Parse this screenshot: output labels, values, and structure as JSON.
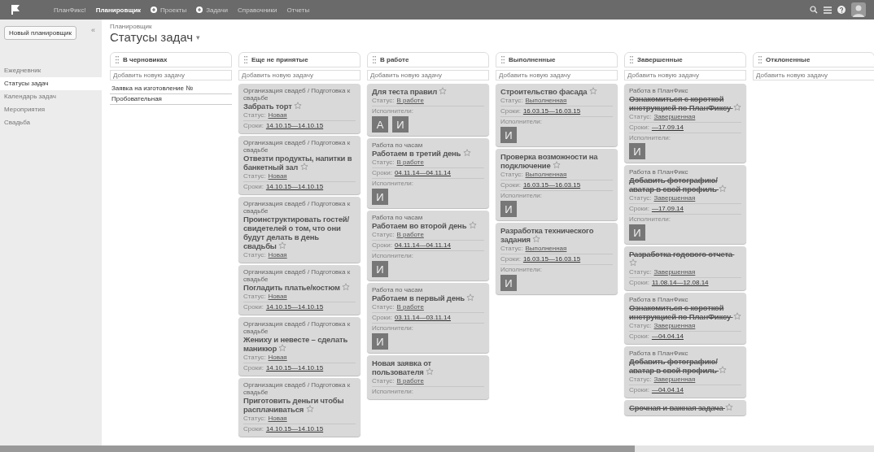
{
  "topbar": {
    "nav": [
      {
        "label": "ПланФикс!",
        "selected": false,
        "plus": false
      },
      {
        "label": "Планировщик",
        "selected": true,
        "plus": false
      },
      {
        "label": "Проекты",
        "selected": false,
        "plus": true
      },
      {
        "label": "Задачи",
        "selected": false,
        "plus": true
      },
      {
        "label": "Справочники",
        "selected": false,
        "plus": false
      },
      {
        "label": "Отчеты",
        "selected": false,
        "plus": false
      }
    ]
  },
  "sidebar": {
    "collapse": "«",
    "new_button": "Новый планировщик",
    "items": [
      {
        "label": "Ежедневник",
        "selected": false
      },
      {
        "label": "Статусы задач",
        "selected": true
      },
      {
        "label": "Календарь задач",
        "selected": false
      },
      {
        "label": "Мероприятия",
        "selected": false
      },
      {
        "label": "Свадьба",
        "selected": false
      }
    ]
  },
  "header": {
    "breadcrumb": "Планировщик",
    "title": "Статусы задач",
    "caret": "▾"
  },
  "columns": [
    {
      "title": "В черновиках",
      "placeholder": "Добавить новую задачу",
      "list": [
        "Заявка на изготовление №",
        "Пробовательная"
      ]
    },
    {
      "title": "Еще не принятые",
      "placeholder": "Добавить новую задачу",
      "cards": [
        {
          "project": "Организация свадеб / Подготовка к свадьбе",
          "title": "Забрать торт",
          "completed": false,
          "status_label": "Статус:",
          "status": "Новая",
          "dates_label": "Сроки:",
          "dates": "14.10.15—14.10.15"
        },
        {
          "project": "Организация свадеб / Подготовка к свадьбе",
          "title": "Отвезти продукты, напитки в банкетный зал",
          "completed": false,
          "status_label": "Статус:",
          "status": "Новая",
          "dates_label": "Сроки:",
          "dates": "14.10.15—14.10.15"
        },
        {
          "project": "Организация свадеб / Подготовка к свадьбе",
          "title": "Проинструктировать гостей/свидетелей о том, что они будут делать в день свадьбы",
          "completed": false,
          "status_label": "Статус:",
          "status": "Новая"
        },
        {
          "project": "Организация свадеб / Подготовка к свадьбе",
          "title": "Погладить платье/костюм",
          "completed": false,
          "status_label": "Статус:",
          "status": "Новая",
          "dates_label": "Сроки:",
          "dates": "14.10.15—14.10.15"
        },
        {
          "project": "Организация свадеб / Подготовка к свадьбе",
          "title": "Жениху и невесте – сделать маникюр",
          "completed": false,
          "status_label": "Статус:",
          "status": "Новая",
          "dates_label": "Сроки:",
          "dates": "14.10.15—14.10.15"
        },
        {
          "project": "Организация свадеб / Подготовка к свадьбе",
          "title": "Приготовить деньги чтобы расплачиваться",
          "completed": false,
          "status_label": "Статус:",
          "status": "Новая",
          "dates_label": "Сроки:",
          "dates": "14.10.15—14.10.15"
        }
      ]
    },
    {
      "title": "В работе",
      "placeholder": "Добавить новую задачу",
      "cards": [
        {
          "title": "Для теста правил",
          "completed": false,
          "status_label": "Статус:",
          "status": "В работе",
          "assignees_label": "Исполнители:",
          "assignees": [
            "А",
            "И"
          ]
        },
        {
          "project": "Работа по часам",
          "title": "Работаем в третий день",
          "completed": false,
          "status_label": "Статус:",
          "status": "В работе",
          "dates_label": "Сроки:",
          "dates": "04.11.14—04.11.14",
          "assignees_label": "Исполнители:",
          "assignees": [
            "И"
          ]
        },
        {
          "project": "Работа по часам",
          "title": "Работаем во второй день",
          "completed": false,
          "status_label": "Статус:",
          "status": "В работе",
          "dates_label": "Сроки:",
          "dates": "04.11.14—04.11.14",
          "assignees_label": "Исполнители:",
          "assignees": [
            "И"
          ]
        },
        {
          "project": "Работа по часам",
          "title": "Работаем в первый день",
          "completed": false,
          "status_label": "Статус:",
          "status": "В работе",
          "dates_label": "Сроки:",
          "dates": "03.11.14—03.11.14",
          "assignees_label": "Исполнители:",
          "assignees": [
            "И"
          ]
        },
        {
          "title": "Новая заявка от пользователя",
          "completed": false,
          "status_label": "Статус:",
          "status": "В работе",
          "assignees_label": "Исполнители:"
        }
      ]
    },
    {
      "title": "Выполненные",
      "placeholder": "Добавить новую задачу",
      "cards": [
        {
          "title": "Строительство фасада",
          "completed": false,
          "status_label": "Статус:",
          "status": "Выполненная",
          "dates_label": "Сроки:",
          "dates": "16.03.15—16.03.15",
          "assignees_label": "Исполнители:",
          "assignees": [
            "И"
          ]
        },
        {
          "title": "Проверка возможности на подключение",
          "completed": false,
          "status_label": "Статус:",
          "status": "Выполненная",
          "dates_label": "Сроки:",
          "dates": "16.03.15—16.03.15",
          "assignees_label": "Исполнители:",
          "assignees": [
            "И"
          ]
        },
        {
          "title": "Разработка технического задания",
          "completed": false,
          "status_label": "Статус:",
          "status": "Выполненная",
          "dates_label": "Сроки:",
          "dates": "16.03.15—16.03.15",
          "assignees_label": "Исполнители:",
          "assignees": [
            "И"
          ]
        }
      ]
    },
    {
      "title": "Завершенные",
      "placeholder": "Добавить новую задачу",
      "cards": [
        {
          "project": "Работа в ПланФикс",
          "title": "Ознакомиться с короткой инструкцией по ПланФиксу",
          "completed": true,
          "status_label": "Статус:",
          "status": "Завершенная",
          "dates_label": "Сроки:",
          "dates": "—17.09.14",
          "assignees_label": "Исполнители:",
          "assignees": [
            "И"
          ]
        },
        {
          "project": "Работа в ПланФикс",
          "title": "Добавить фотографию/аватар в свой профиль",
          "completed": true,
          "status_label": "Статус:",
          "status": "Завершенная",
          "dates_label": "Сроки:",
          "dates": "—17.09.14",
          "assignees_label": "Исполнители:",
          "assignees": [
            "И"
          ]
        },
        {
          "title": "Разработка годового отчета",
          "completed": true,
          "status_label": "Статус:",
          "status": "Завершенная",
          "dates_label": "Сроки:",
          "dates": "11.08.14—12.08.14"
        },
        {
          "project": "Работа в ПланФикс",
          "title": "Ознакомиться с короткой инструкцией по ПланФиксу",
          "completed": true,
          "status_label": "Статус:",
          "status": "Завершенная",
          "dates_label": "Сроки:",
          "dates": "—04.04.14"
        },
        {
          "project": "Работа в ПланФикс",
          "title": "Добавить фотографию/аватар в свой профиль",
          "completed": true,
          "status_label": "Статус:",
          "status": "Завершенная",
          "dates_label": "Сроки:",
          "dates": "—04.04.14"
        },
        {
          "title": "Срочная и важная задача",
          "completed": true
        }
      ]
    },
    {
      "title": "Отклоненные",
      "placeholder": "Добавить новую задачу"
    }
  ]
}
